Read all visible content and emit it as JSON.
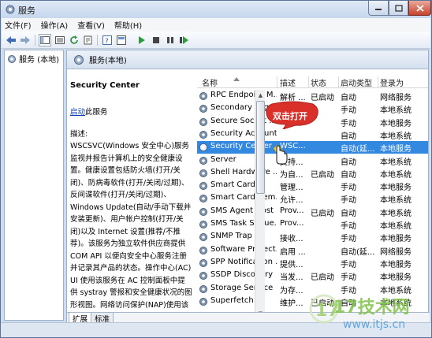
{
  "window": {
    "title": "服务",
    "menus": [
      "文件(F)",
      "操作(A)",
      "查看(V)",
      "帮助(H)"
    ]
  },
  "tree": {
    "root_label": "服务 (本地)"
  },
  "pane": {
    "header_title": "服务(本地)"
  },
  "description": {
    "service_name": "Security Center",
    "start_link": "启动",
    "start_suffix": "此服务",
    "label": "描述:",
    "text": "WSCSVC(Windows 安全中心)服务监视并报告计算机上的安全健康设置。健康设置包括防火墙(打开/关闭)、防病毒软件(打开/关闭/过期)、反间谍软件(打开/关闭/过期)、Windows Update(自动/手动下载并安装更新)、用户帐户控制(打开/关闭)以及 Internet 设置(推荐/不推荐)。该服务为独立软件供应商提供 COM API 以便向安全中心服务注册并记录其产品的状态。操作中心(AC) UI 使用该服务在 AC 控制面板中提供 systray 警报和安全健康状况的图形视图。网络访问保护(NAP)使用该服务向 NAP 网络策略服务器报告客户端的"
  },
  "columns": {
    "name": "名称",
    "desc": "描述",
    "status": "状态",
    "startup": "启动类型",
    "logon": "登录为"
  },
  "services": [
    {
      "name": "RPC Endpoint M...",
      "desc": "解析 ...",
      "status": "已启动",
      "startup": "自动",
      "logon": "网络服务"
    },
    {
      "name": "Secondary Logon",
      "desc": "",
      "status": "",
      "startup": "手动",
      "logon": "本地系统"
    },
    {
      "name": "Secure Socket ...",
      "desc": "",
      "status": "",
      "startup": "手动",
      "logon": "本地服务"
    },
    {
      "name": "Security Account...",
      "desc": "",
      "status": "",
      "startup": "自动",
      "logon": "本地系统"
    },
    {
      "name": "Security Center",
      "desc": "WSC...",
      "status": "",
      "startup": "自动(延...",
      "logon": "本地服务",
      "selected": true
    },
    {
      "name": "Server",
      "desc": "支持...",
      "status": "",
      "startup": "自动",
      "logon": "本地系统"
    },
    {
      "name": "Shell Hardware ...",
      "desc": "为自...",
      "status": "已启动",
      "startup": "自动",
      "logon": "本地系统"
    },
    {
      "name": "Smart Card",
      "desc": "管理...",
      "status": "",
      "startup": "手动",
      "logon": "本地服务"
    },
    {
      "name": "Smart Card Rem...",
      "desc": "允许...",
      "status": "",
      "startup": "手动",
      "logon": "本地系统"
    },
    {
      "name": "SMS Agent Host",
      "desc": "Prov...",
      "status": "已启动",
      "startup": "自动",
      "logon": "本地系统"
    },
    {
      "name": "SMS Task Seque...",
      "desc": "Prov...",
      "status": "",
      "startup": "手动",
      "logon": "本地系统"
    },
    {
      "name": "SNMP Trap",
      "desc": "接收...",
      "status": "",
      "startup": "手动",
      "logon": "本地服务"
    },
    {
      "name": "Software Protect...",
      "desc": "启用 ...",
      "status": "",
      "startup": "自动(延...",
      "logon": "网络服务"
    },
    {
      "name": "SPP Notification ...",
      "desc": "提供...",
      "status": "",
      "startup": "手动",
      "logon": "本地服务"
    },
    {
      "name": "SSDP Discovery",
      "desc": "当发...",
      "status": "已启动",
      "startup": "手动",
      "logon": "本地服务"
    },
    {
      "name": "Storage Service",
      "desc": "为存...",
      "status": "",
      "startup": "手动",
      "logon": "本地系统"
    },
    {
      "name": "Superfetch",
      "desc": "维护...",
      "status": "已启动",
      "startup": "自动",
      "logon": "本地系统"
    }
  ],
  "tabs": {
    "extended": "扩展",
    "standard": "标准"
  },
  "callout": {
    "text": "双击打开"
  },
  "watermark": {
    "big": "17技术网",
    "url": "www.itjs.cn"
  },
  "colors": {
    "selection": "#3388e0",
    "link": "#0b3cb5",
    "callout": "#d9302a"
  }
}
